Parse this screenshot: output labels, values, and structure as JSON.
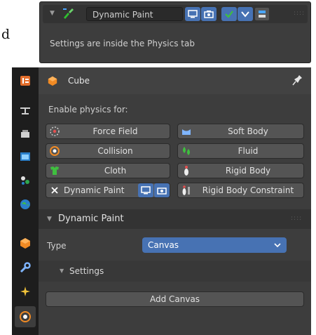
{
  "top_strip": {
    "crop_text": "d",
    "modifier_panel": {
      "modifier_name": "Dynamic Paint",
      "info_text": "Settings are inside the Physics tab"
    }
  },
  "properties": {
    "tabs": [
      "tool",
      "render",
      "output",
      "view-layer",
      "scene",
      "world",
      "object",
      "modifiers",
      "particles",
      "physics"
    ],
    "active_tab": "physics",
    "object_name": "Cube",
    "enable_label": "Enable physics for:",
    "physics_buttons": [
      {
        "label": "Force Field",
        "icon": "force-field-icon"
      },
      {
        "label": "Soft Body",
        "icon": "soft-body-icon"
      },
      {
        "label": "Collision",
        "icon": "collision-icon"
      },
      {
        "label": "Fluid",
        "icon": "fluid-icon"
      },
      {
        "label": "Cloth",
        "icon": "cloth-icon"
      },
      {
        "label": "Rigid Body",
        "icon": "rigid-body-icon"
      },
      {
        "label": "Dynamic Paint",
        "icon": "close-icon",
        "enabled": true
      },
      {
        "label": "Rigid Body Constraint",
        "icon": "rigid-body-constraint-icon"
      }
    ],
    "dynamic_paint": {
      "title": "Dynamic Paint",
      "type_label": "Type",
      "type_value": "Canvas",
      "settings_label": "Settings",
      "add_button": "Add Canvas"
    }
  },
  "colors": {
    "accent": "#4772b3",
    "panel": "#3d3d3d",
    "check_green": "#3fbf3f"
  }
}
